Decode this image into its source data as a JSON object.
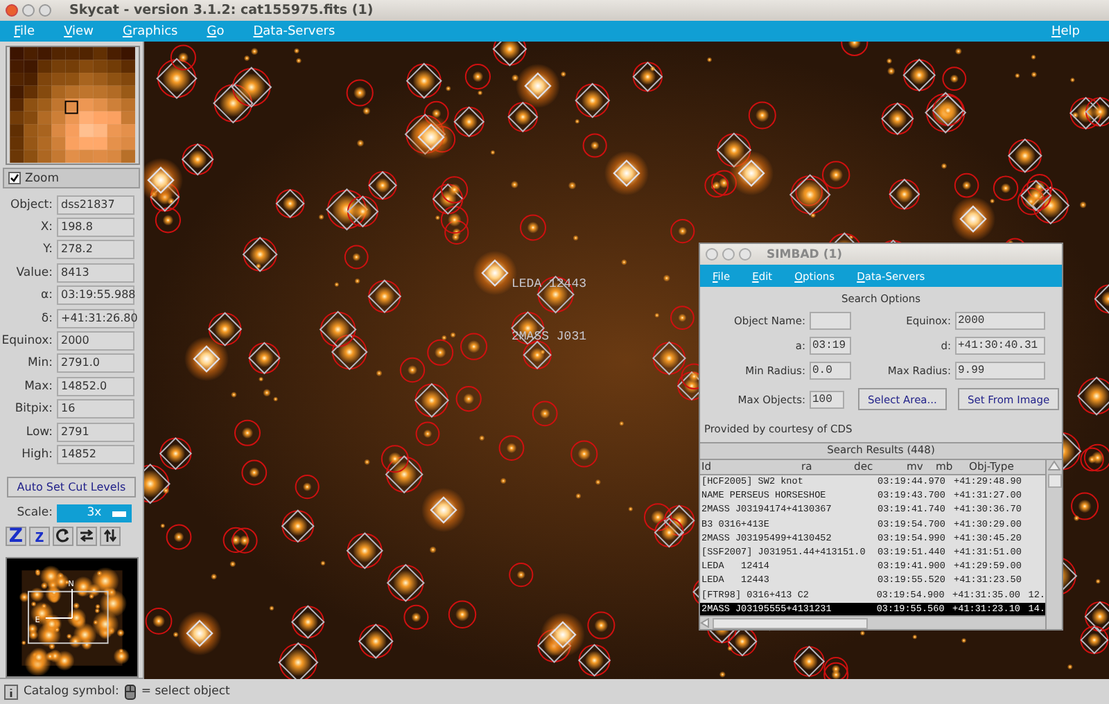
{
  "window": {
    "title": "Skycat - version 3.1.2: cat155975.fits (1)"
  },
  "menu": [
    {
      "label": "File"
    },
    {
      "label": "View"
    },
    {
      "label": "Graphics"
    },
    {
      "label": "Go"
    },
    {
      "label": "Data-Servers"
    }
  ],
  "help_menu": {
    "label": "Help"
  },
  "zoom": {
    "label": "Zoom",
    "checked": true
  },
  "fields": [
    {
      "label": "Object:",
      "value": "dss21837"
    },
    {
      "label": "X:",
      "value": "198.8"
    },
    {
      "label": "Y:",
      "value": "278.2"
    },
    {
      "label": "Value:",
      "value": "8413"
    },
    {
      "label": "α:",
      "value": "03:19:55.988"
    },
    {
      "label": "δ:",
      "value": "+41:31:26.80"
    },
    {
      "label": "Equinox:",
      "value": "2000"
    },
    {
      "label": "Min:",
      "value": "2791.0"
    },
    {
      "label": "Max:",
      "value": "14852.0"
    },
    {
      "label": "Bitpix:",
      "value": "16"
    },
    {
      "label": "Low:",
      "value": "2791"
    },
    {
      "label": "High:",
      "value": "14852"
    }
  ],
  "cut_button": "Auto Set Cut Levels",
  "scale": {
    "label": "Scale:",
    "value": "3x"
  },
  "zoom_buttons": [
    "Z",
    "z"
  ],
  "panner": {
    "north": "N",
    "east": "E"
  },
  "image_labels": [
    {
      "text": "LEDA 12443"
    },
    {
      "text": "2MASS J031"
    }
  ],
  "simbad": {
    "title": "SIMBAD (1)",
    "menu": [
      {
        "label": "File"
      },
      {
        "label": "Edit"
      },
      {
        "label": "Options"
      },
      {
        "label": "Data-Servers"
      }
    ],
    "section": "Search Options",
    "object_name": {
      "label": "Object Name:"
    },
    "equinox": {
      "label": "Equinox:",
      "value": "2000"
    },
    "a": {
      "label": "a:",
      "value": "03:19"
    },
    "d": {
      "label": "d:",
      "value": "+41:30:40.31"
    },
    "min_radius": {
      "label": "Min Radius:",
      "value": "0.0"
    },
    "max_radius": {
      "label": "Max Radius:",
      "value": "9.99"
    },
    "max_objects": {
      "label": "Max Objects:",
      "value": "100"
    },
    "buttons": [
      "Select Area...",
      "Set From Image"
    ],
    "credit": "Provided by courtesy of CDS",
    "results_title": "Search Results (448)",
    "columns": [
      "Id",
      "ra",
      "dec",
      "mv",
      "mb",
      "Obj-Type"
    ],
    "rows": [
      {
        "id": "[HCF2005] SW2 knot",
        "ra": "03:19:44.970",
        "dec": "+41:29:48.90",
        "extra": "",
        "selected": false
      },
      {
        "id": "NAME PERSEUS HORSESHOE",
        "ra": "03:19:43.700",
        "dec": "+41:31:27.00",
        "extra": "",
        "selected": false
      },
      {
        "id": "2MASS J03194174+4130367",
        "ra": "03:19:41.740",
        "dec": "+41:30:36.70",
        "extra": "",
        "selected": false
      },
      {
        "id": "B3 0316+413E",
        "ra": "03:19:54.700",
        "dec": "+41:30:29.00",
        "extra": "",
        "selected": false
      },
      {
        "id": "2MASS J03195499+4130452",
        "ra": "03:19:54.990",
        "dec": "+41:30:45.20",
        "extra": "",
        "selected": false
      },
      {
        "id": "[SSF2007] J031951.44+413151.0",
        "ra": "03:19:51.440",
        "dec": "+41:31:51.00",
        "extra": "",
        "selected": false
      },
      {
        "id": "LEDA   12414",
        "ra": "03:19:41.900",
        "dec": "+41:29:59.00",
        "extra": "",
        "selected": false
      },
      {
        "id": "LEDA   12443",
        "ra": "03:19:55.520",
        "dec": "+41:31:23.50",
        "extra": "",
        "selected": false
      },
      {
        "id": "[FTR98] 0316+413 C2",
        "ra": "03:19:54.900",
        "dec": "+41:31:35.00",
        "extra": "12.",
        "selected": false
      },
      {
        "id": "2MASS J03195555+4131231",
        "ra": "03:19:55.560",
        "dec": "+41:31:23.10",
        "extra": "14.",
        "selected": true
      }
    ]
  },
  "status": {
    "text": "Catalog symbol:",
    "hint": "= select object"
  }
}
